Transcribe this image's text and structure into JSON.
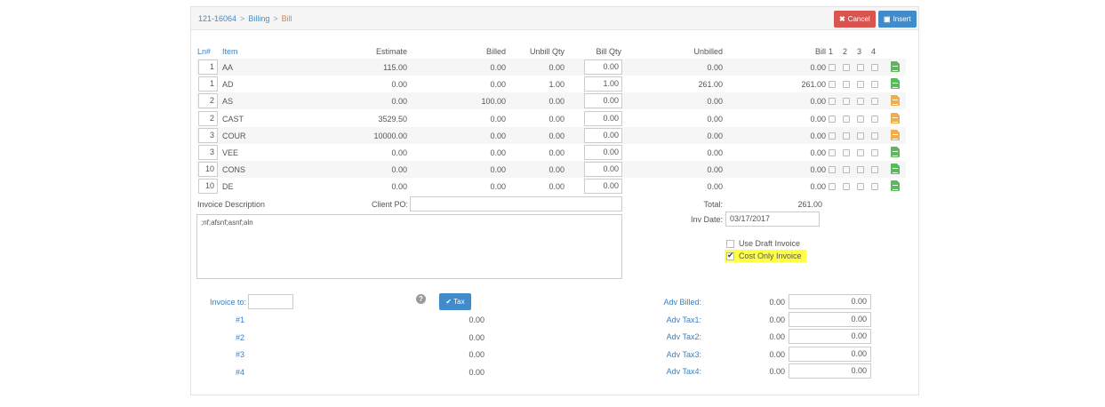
{
  "breadcrumb": {
    "project": "121-16064",
    "section": "Billing",
    "current": "Bill",
    "sep": ">"
  },
  "toolbar": {
    "cancel_label": "Cancel",
    "insert_label": "Insert"
  },
  "columns": {
    "ln": "Ln#",
    "item": "Item",
    "estimate": "Estimate",
    "billed": "Billed",
    "unbill_qty": "Unbill Qty",
    "bill_qty": "Bill Qty",
    "unbilled": "Unbilled",
    "bill": "Bill",
    "c1": "1",
    "c2": "2",
    "c3": "3",
    "c4": "4"
  },
  "rows": [
    {
      "ln": "1",
      "item": "AA",
      "estimate": "115.00",
      "billed": "0.00",
      "unbill_qty": "0.00",
      "bill_qty": "0.00",
      "unbilled": "0.00",
      "bill": "0.00",
      "doc": "green"
    },
    {
      "ln": "1",
      "item": "AD",
      "estimate": "0.00",
      "billed": "0.00",
      "unbill_qty": "1.00",
      "bill_qty": "1.00",
      "unbilled": "261.00",
      "bill": "261.00",
      "doc": "green"
    },
    {
      "ln": "2",
      "item": "AS",
      "estimate": "0.00",
      "billed": "100.00",
      "unbill_qty": "0.00",
      "bill_qty": "0.00",
      "unbilled": "0.00",
      "bill": "0.00",
      "doc": "orange"
    },
    {
      "ln": "2",
      "item": "CAST",
      "estimate": "3529.50",
      "billed": "0.00",
      "unbill_qty": "0.00",
      "bill_qty": "0.00",
      "unbilled": "0.00",
      "bill": "0.00",
      "doc": "orange"
    },
    {
      "ln": "3",
      "item": "COUR",
      "estimate": "10000.00",
      "billed": "0.00",
      "unbill_qty": "0.00",
      "bill_qty": "0.00",
      "unbilled": "0.00",
      "bill": "0.00",
      "doc": "orange"
    },
    {
      "ln": "3",
      "item": "VEE",
      "estimate": "0.00",
      "billed": "0.00",
      "unbill_qty": "0.00",
      "bill_qty": "0.00",
      "unbilled": "0.00",
      "bill": "0.00",
      "doc": "green"
    },
    {
      "ln": "10",
      "item": "CONS",
      "estimate": "0.00",
      "billed": "0.00",
      "unbill_qty": "0.00",
      "bill_qty": "0.00",
      "unbilled": "0.00",
      "bill": "0.00",
      "doc": "green"
    },
    {
      "ln": "10",
      "item": "DE",
      "estimate": "0.00",
      "billed": "0.00",
      "unbill_qty": "0.00",
      "bill_qty": "0.00",
      "unbilled": "0.00",
      "bill": "0.00",
      "doc": "green"
    }
  ],
  "form": {
    "invoice_desc_label": "Invoice Description",
    "invoice_desc_value": ";nf;afsnf;asnf;aln",
    "client_po_label": "Client PO:",
    "client_po_value": "",
    "total_label": "Total:",
    "total_value": "261.00",
    "inv_date_label": "Inv Date:",
    "inv_date_value": "03/17/2017",
    "use_draft_label": "Use Draft Invoice",
    "cost_only_label": "Cost Only Invoice"
  },
  "bottom": {
    "invoice_to_label": "Invoice to:",
    "invoice_to_value": "",
    "help_glyph": "?",
    "tax_label": "Tax",
    "lines": [
      {
        "label": "#1",
        "value": "0.00"
      },
      {
        "label": "#2",
        "value": "0.00"
      },
      {
        "label": "#3",
        "value": "0.00"
      },
      {
        "label": "#4",
        "value": "0.00"
      }
    ],
    "adv": [
      {
        "label": "Adv Billed:",
        "value": "0.00",
        "input": "0.00"
      },
      {
        "label": "Adv Tax1:",
        "value": "0.00",
        "input": "0.00"
      },
      {
        "label": "Adv Tax2:",
        "value": "0.00",
        "input": "0.00"
      },
      {
        "label": "Adv Tax3:",
        "value": "0.00",
        "input": "0.00"
      },
      {
        "label": "Adv Tax4:",
        "value": "0.00",
        "input": "0.00"
      }
    ]
  },
  "colors": {
    "accent": "#428bca",
    "danger": "#d9534f",
    "link": "#3b7fc4",
    "breadcrumb_current": "#e8793e",
    "doc_green": "#5cb85c",
    "doc_orange": "#f0ad4e",
    "highlight": "#ffff44"
  }
}
